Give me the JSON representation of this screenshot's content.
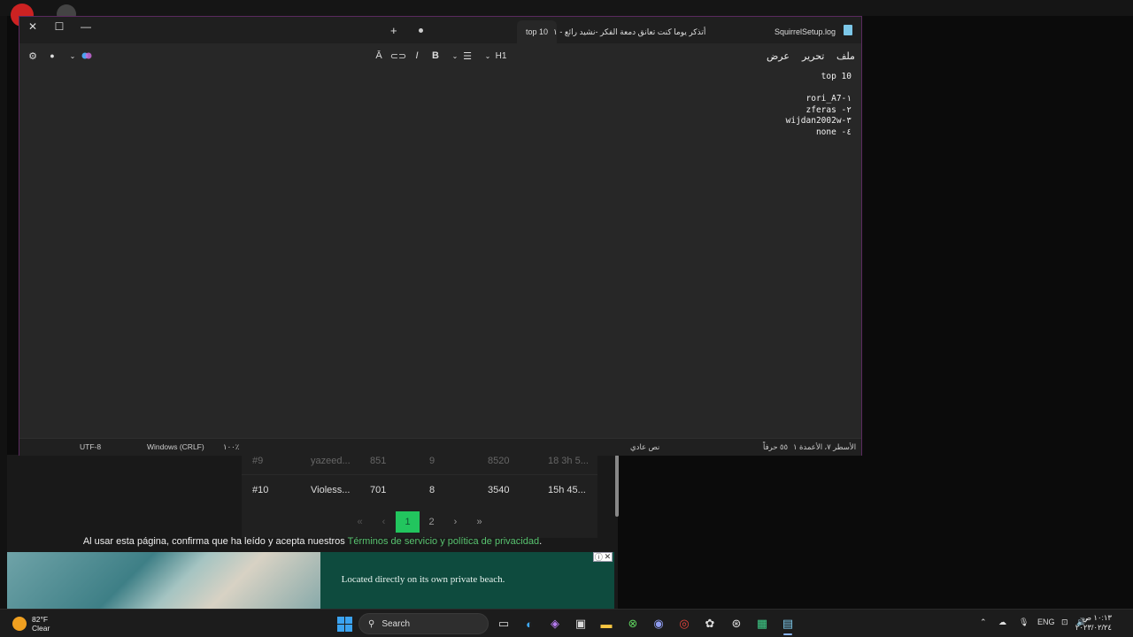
{
  "notepad": {
    "window_controls": {
      "close": "✕",
      "maximize": "☐",
      "minimize": "—"
    },
    "tabs": [
      {
        "label": "SquirrelSetup.log"
      },
      {
        "label": "أتذكر يوما كنت تعانق دمعة الفكر -نشيد رائع - ١"
      },
      {
        "label": "top 10"
      }
    ],
    "new_tab_label": "+",
    "menu": {
      "file": "ملف",
      "edit": "تحرير",
      "view": "عرض"
    },
    "toolbar": {
      "heading": "H1",
      "bold": "B",
      "italic": "I"
    },
    "content": {
      "title": "top 10",
      "items": [
        "rori_A7-١",
        "zferas -٢",
        "wijdan2002w-٣",
        "none -٤"
      ]
    },
    "status": {
      "position": "الأسطر ٧، الأعمدة ١",
      "chars": "٥٥ حرفاً",
      "mode": "نص عادي",
      "zoom": "١٠٠٪",
      "line_ending": "Windows (CRLF)",
      "encoding": "UTF-8"
    }
  },
  "background_page": {
    "rows": [
      {
        "rank": "#9",
        "name": "yazeed...",
        "a": "851",
        "b": "9",
        "c": "8520",
        "d": "18 3h 5..."
      },
      {
        "rank": "#10",
        "name": "Violess...",
        "a": "701",
        "b": "8",
        "c": "3540",
        "d": "15h 45..."
      }
    ],
    "pager": {
      "first": "«",
      "prev": "‹",
      "page1": "1",
      "page2": "2",
      "next": "›",
      "last": "»"
    },
    "consent_text": "Al usar esta página, confirma que ha leído y acepta nuestros",
    "consent_link": "Términos de servicio y política de privacidad",
    "consent_end": ".",
    "ad_text": "Located directly on its own private beach.",
    "ad_close": "✕"
  },
  "taskbar": {
    "weather_temp": "82°F",
    "weather_desc": "Clear",
    "search_label": "Search",
    "lang": "ENG",
    "time": "١٠:١٣ ص",
    "date": "٢٠٢٣/٠٢/٢٤"
  },
  "colors": {
    "accent": "#22c55e",
    "window_border": "#5a2a5e",
    "link": "#58c26f"
  }
}
